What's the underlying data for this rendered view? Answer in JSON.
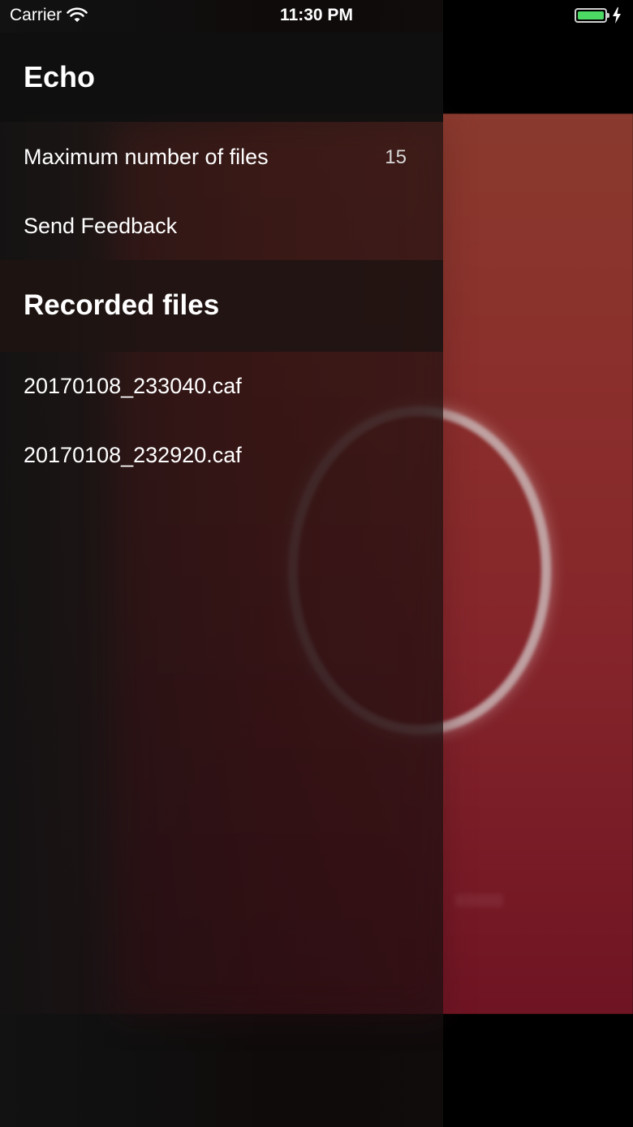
{
  "status_bar": {
    "carrier": "Carrier",
    "time": "11:30 PM",
    "battery_color": "#4cd964"
  },
  "drawer": {
    "title": "Echo",
    "settings": [
      {
        "label": "Maximum number of files",
        "value": "15"
      },
      {
        "label": "Send Feedback",
        "value": ""
      }
    ],
    "files_section_title": "Recorded files",
    "files": [
      {
        "name": "20170108_233040.caf"
      },
      {
        "name": "20170108_232920.caf"
      }
    ]
  },
  "icons": {
    "wifi": "wifi-icon",
    "battery": "battery-icon",
    "charging": "bolt-icon"
  }
}
